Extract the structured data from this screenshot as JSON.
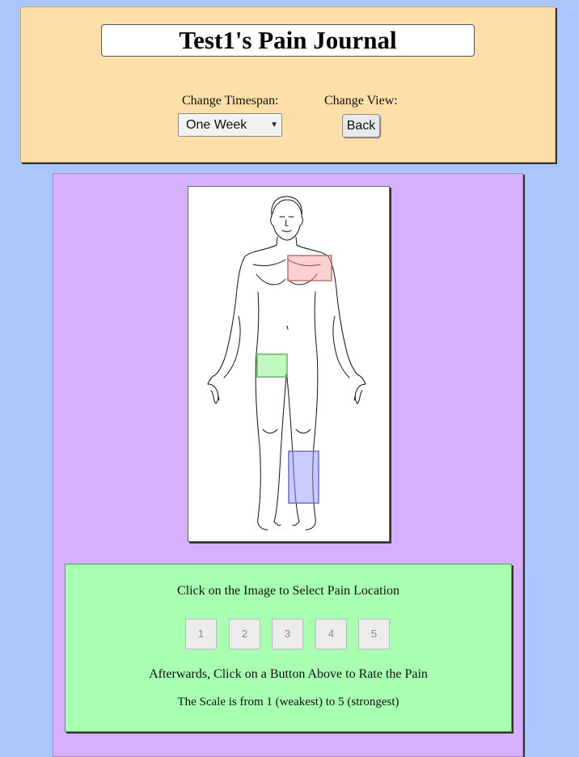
{
  "header": {
    "title": "Test1's Pain Journal",
    "timespan_label": "Change Timespan:",
    "timespan_selected": "One Week",
    "view_label": "Change View:",
    "back_label": "Back"
  },
  "body_map": {
    "markers": [
      {
        "color": "#ff9696",
        "area": "upper-left-chest"
      },
      {
        "color": "#8cf58c",
        "area": "right-hip"
      },
      {
        "color": "#9696ff",
        "area": "left-shin"
      }
    ]
  },
  "rating": {
    "instruction_top": "Click on the Image to Select Pain Location",
    "buttons": [
      "1",
      "2",
      "3",
      "4",
      "5"
    ],
    "instruction_bottom": "Afterwards, Click on a Button Above to Rate the Pain",
    "scale_note": "The Scale is from 1 (weakest) to 5 (strongest)"
  },
  "colors": {
    "page_background": "#abc6fb",
    "header_background": "#ffdfa8",
    "main_background": "#d7b0fd",
    "rating_background": "#a8ffb1"
  }
}
